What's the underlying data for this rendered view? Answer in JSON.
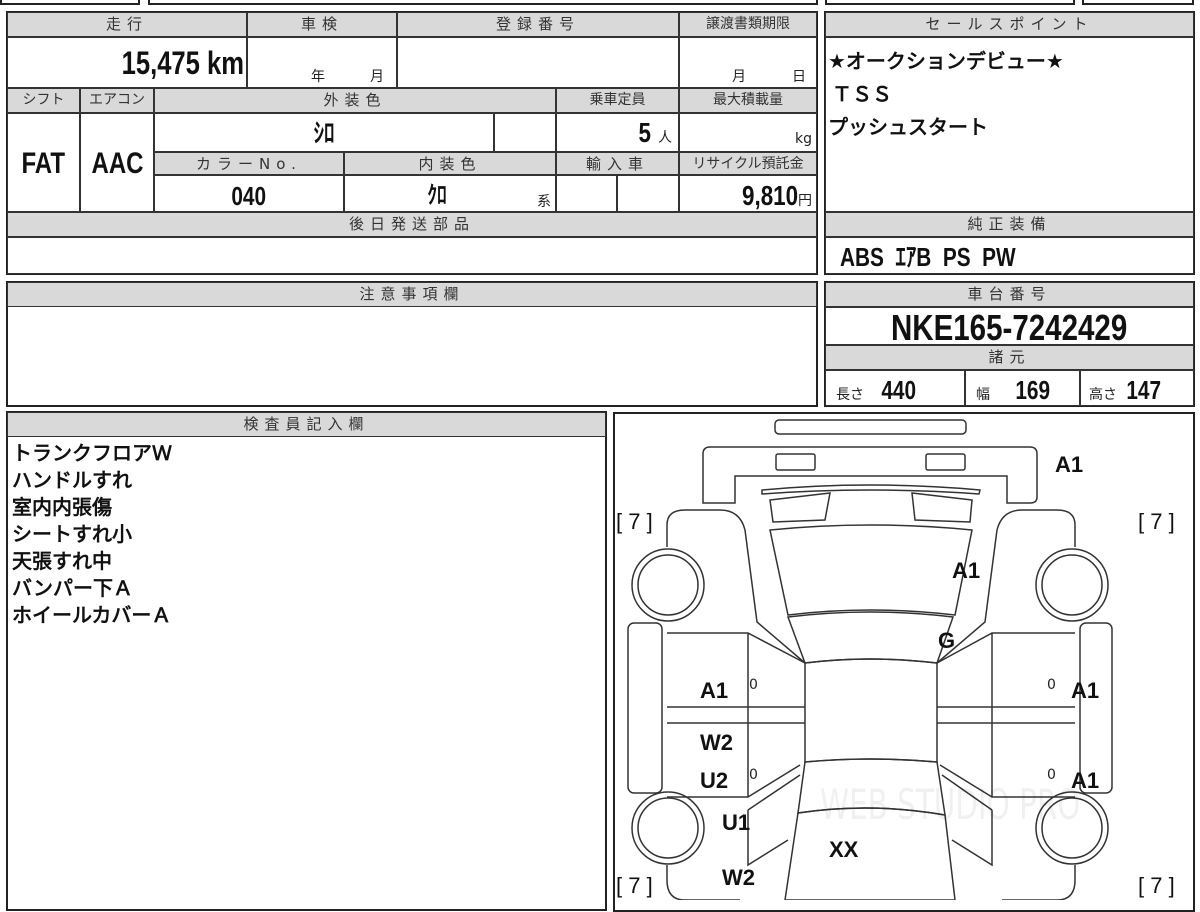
{
  "mileage": {
    "label": "走行",
    "value": "15,475",
    "unit": "km"
  },
  "inspection": {
    "label": "車検",
    "year": "年",
    "month": "月"
  },
  "registration": {
    "label": "登録番号",
    "value": ""
  },
  "transfer_deadline": {
    "label": "譲渡書類期限",
    "month": "月",
    "day": "日"
  },
  "shift": {
    "label": "シフト",
    "value": "FAT"
  },
  "aircon": {
    "label": "エアコン",
    "value": "AAC"
  },
  "exterior_color": {
    "label": "外装色",
    "value": "ｼﾛ"
  },
  "capacity": {
    "label": "乗車定員",
    "value": "5",
    "unit": "人"
  },
  "max_load": {
    "label": "最大積載量",
    "unit": "kg"
  },
  "color_no": {
    "label": "カラーNo.",
    "value": "040"
  },
  "interior_color": {
    "label": "内装色",
    "value": "ｸﾛ",
    "suffix": "系"
  },
  "import": {
    "label": "輸入車"
  },
  "recycle": {
    "label": "リサイクル預託金",
    "value": "9,810",
    "unit": "円"
  },
  "later_parts": {
    "label": "後日発送部品"
  },
  "sales_points": {
    "label": "セールスポイント",
    "lines": [
      "★オークションデビュー★",
      "ＴＳＳ",
      "プッシュスタート"
    ]
  },
  "equipment": {
    "label": "純正装備",
    "value": "ABS  ｴｱB  PS  PW"
  },
  "notes": {
    "label": "注意事項欄"
  },
  "chassis": {
    "label": "車台番号",
    "value": "NKE165-7242429"
  },
  "specs": {
    "label": "諸元",
    "length_label": "長さ",
    "length": "440",
    "width_label": "幅",
    "width": "169",
    "height_label": "高さ",
    "height": "147"
  },
  "inspector": {
    "label": "検査員記入欄",
    "lines": [
      "トランクフロアＷ",
      "ハンドルすれ",
      "室内内張傷",
      "シートすれ小",
      "天張すれ中",
      "バンパー下Ａ",
      "ホイールカバーＡ"
    ]
  },
  "diagram": {
    "marks": [
      "A1",
      "[ 7 ]",
      "[ 7 ]",
      "A1",
      "G",
      "A1",
      "0",
      "0",
      "A1",
      "W2",
      "U2",
      "0",
      "0",
      "A1",
      "U1",
      "XX",
      "W2",
      "[ 7 ]",
      "[ 7 ]"
    ],
    "watermark": "WEB STUDIO PRO"
  }
}
